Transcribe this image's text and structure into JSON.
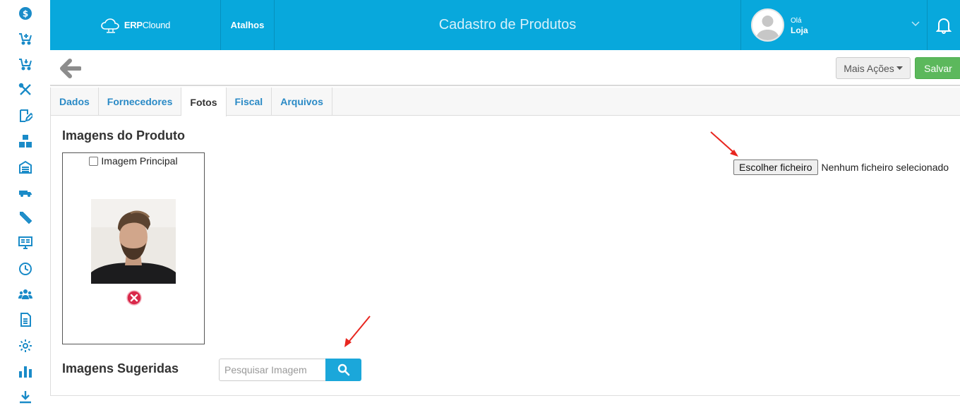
{
  "sidebar": {
    "icons": [
      "dollar-icon",
      "cart-add-icon",
      "cart-icon",
      "tools-icon",
      "edit-icon",
      "boxes-icon",
      "warehouse-icon",
      "truck-icon",
      "pencil-icon",
      "monitor-icon",
      "clock-icon",
      "users-icon",
      "document-icon",
      "settings-icon",
      "chart-icon",
      "download-icon"
    ]
  },
  "header": {
    "brand_bold": "ERP",
    "brand_rest": "Clound",
    "shortcuts": "Atalhos",
    "title": "Cadastro de Produtos",
    "greeting": "Olá",
    "user_name": "Loja",
    "accent": "#08a8dc"
  },
  "toolbar": {
    "more_actions": "Mais Ações",
    "save": "Salvar"
  },
  "tabs": [
    {
      "label": "Dados",
      "active": false
    },
    {
      "label": "Fornecedores",
      "active": false
    },
    {
      "label": "Fotos",
      "active": true
    },
    {
      "label": "Fiscal",
      "active": false
    },
    {
      "label": "Arquivos",
      "active": false
    }
  ],
  "images_section": {
    "title": "Imagens do Produto",
    "main_image_label": "Imagem Principal",
    "choose_file": "Escolher ficheiro",
    "no_file": "Nenhum ficheiro selecionado"
  },
  "suggested_section": {
    "title": "Imagens Sugeridas",
    "search_placeholder": "Pesquisar Imagem"
  }
}
